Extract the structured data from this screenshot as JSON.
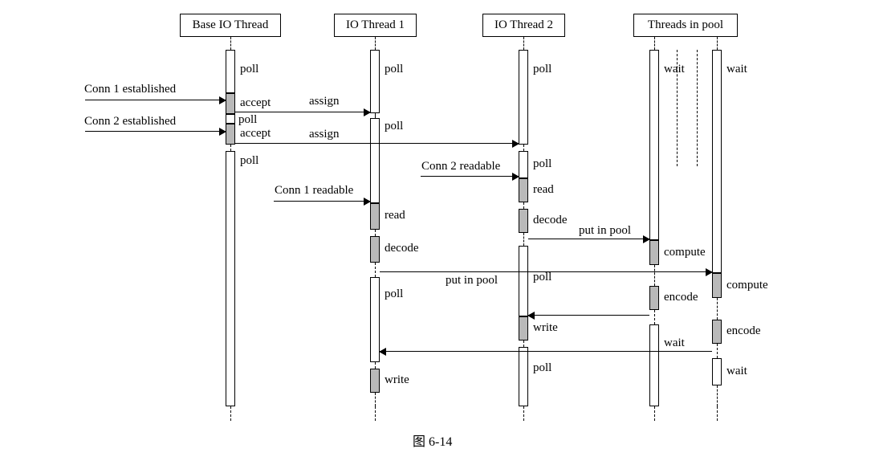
{
  "heads": {
    "base": "Base IO Thread",
    "io1": "IO Thread 1",
    "io2": "IO Thread 2",
    "pool": "Threads in pool"
  },
  "labels": {
    "poll": "poll",
    "wait": "wait",
    "accept": "accept",
    "assign": "assign",
    "read": "read",
    "decode": "decode",
    "encode": "encode",
    "compute": "compute",
    "write": "write",
    "put_in_pool": "put in pool",
    "conn1_est": "Conn 1 established",
    "conn2_est": "Conn 2 established",
    "conn1_readable": "Conn 1 readable",
    "conn2_readable": "Conn 2 readable"
  },
  "caption": "图 6-14"
}
